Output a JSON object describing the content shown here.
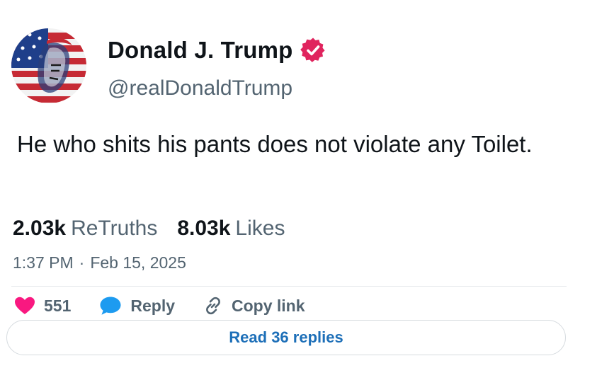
{
  "post": {
    "author": {
      "display_name": "Donald J. Trump",
      "handle": "@realDonaldTrump",
      "verified_icon": "verified-badge-icon",
      "avatar_icon": "flag-portrait-avatar"
    },
    "text": "He who shits his pants does not violate any Toilet.",
    "stats": [
      {
        "value": "2.03k",
        "label": "ReTruths"
      },
      {
        "value": "8.03k",
        "label": "Likes"
      }
    ],
    "time": "1:37 PM",
    "separator": "·",
    "date": "Feb 15, 2025"
  },
  "actions": {
    "like_count": "551",
    "like_icon": "heart-icon",
    "reply_label": "Reply",
    "reply_icon": "speech-bubble-icon",
    "copy_link_label": "Copy link",
    "copy_link_icon": "link-icon"
  },
  "footer": {
    "read_replies_label": "Read 36 replies"
  },
  "colors": {
    "text_primary": "#0f1419",
    "text_secondary": "#536471",
    "verified_badge": "#e0245e",
    "like_heart": "#f91880",
    "reply_bubble": "#1d9bf0",
    "link_text": "#1d6fb8"
  }
}
